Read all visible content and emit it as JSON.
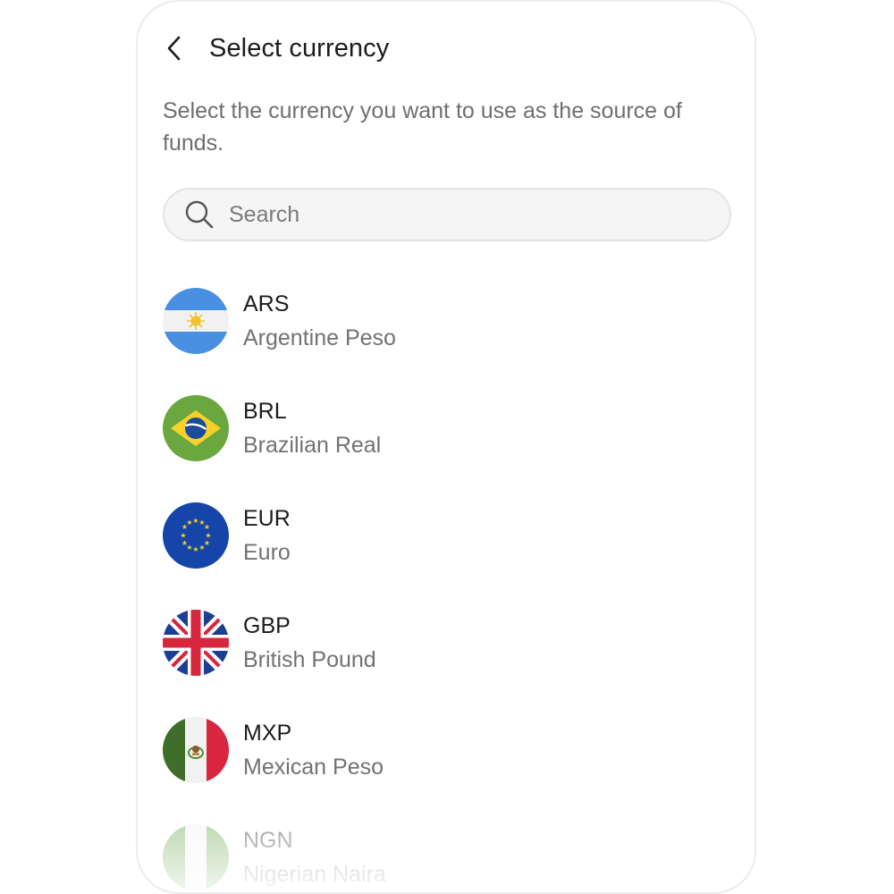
{
  "header": {
    "title": "Select currency",
    "back_icon": "chevron-left-icon"
  },
  "description": "Select the currency you want to use as the source of funds.",
  "search": {
    "placeholder": "Search",
    "value": "",
    "icon": "search-icon"
  },
  "currencies": [
    {
      "code": "ARS",
      "name": "Argentine Peso",
      "flag": "argentina-flag-icon"
    },
    {
      "code": "BRL",
      "name": "Brazilian Real",
      "flag": "brazil-flag-icon"
    },
    {
      "code": "EUR",
      "name": "Euro",
      "flag": "eu-flag-icon"
    },
    {
      "code": "GBP",
      "name": "British Pound",
      "flag": "uk-flag-icon"
    },
    {
      "code": "MXP",
      "name": "Mexican Peso",
      "flag": "mexico-flag-icon"
    },
    {
      "code": "NGN",
      "name": "Nigerian Naira",
      "flag": "nigeria-flag-icon"
    }
  ],
  "colors": {
    "title": "#1c1c1e",
    "secondary_text": "#6f6f73",
    "search_bg": "#f5f5f5",
    "border": "#e4e4e4"
  }
}
